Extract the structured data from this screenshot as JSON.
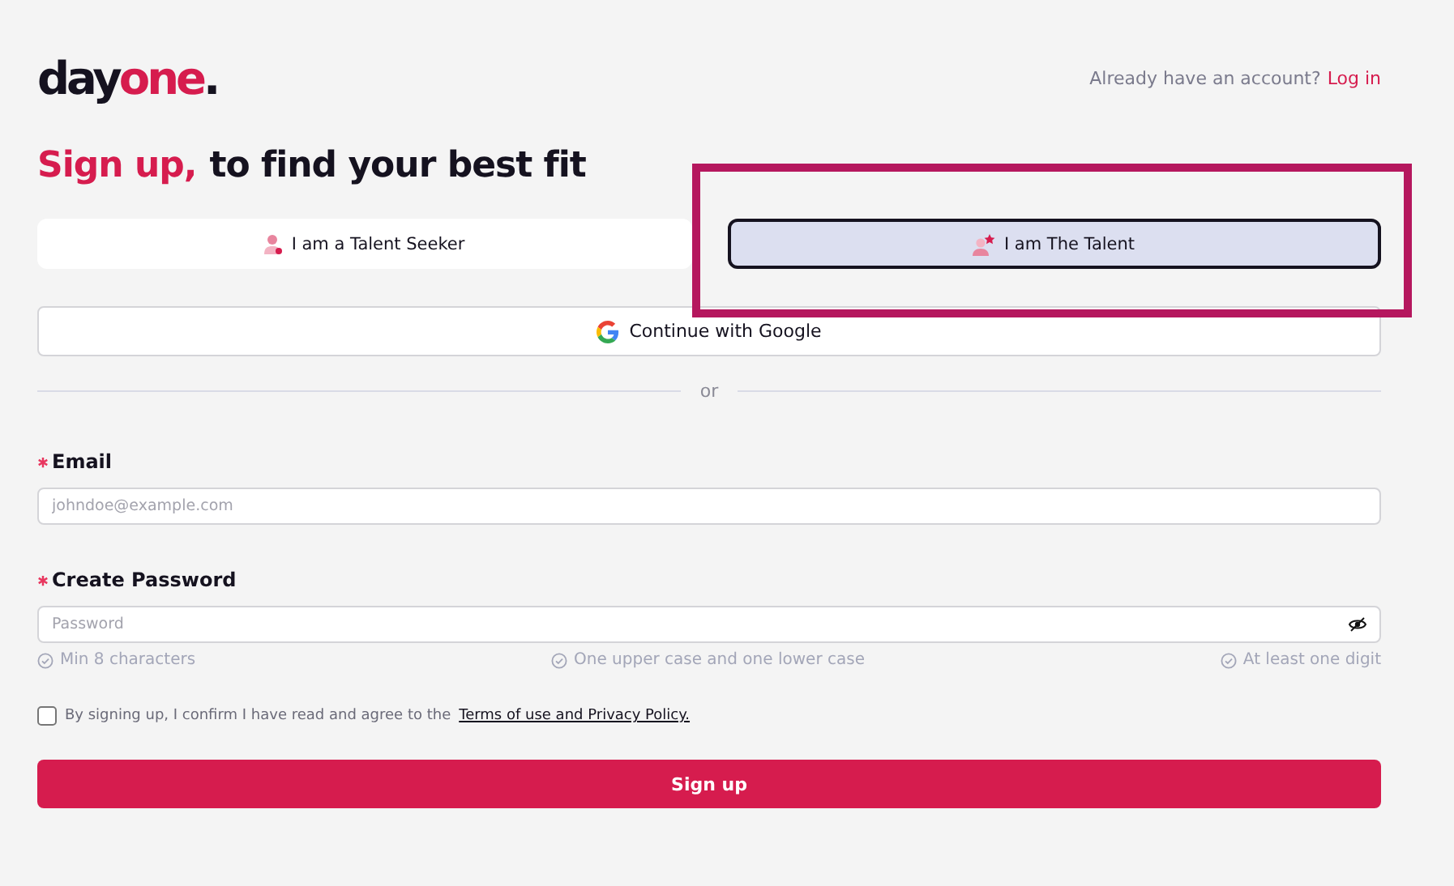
{
  "logo": {
    "first": "day",
    "second": "one",
    "dot": "."
  },
  "login_prompt": {
    "text": "Already have an account?",
    "link": "Log in"
  },
  "heading": {
    "accent": "Sign up,",
    "rest": "to find your best fit"
  },
  "roles": [
    {
      "label": "I am a Talent Seeker",
      "selected": false,
      "highlighted": false
    },
    {
      "label": "I am The Talent",
      "selected": true,
      "highlighted": true
    }
  ],
  "google_button": "Continue with Google",
  "divider": "or",
  "fields": [
    {
      "label": "Email",
      "required": true,
      "placeholder": "johndoe@example.com",
      "kind": "text"
    },
    {
      "label": "Create Password",
      "required": true,
      "placeholder": "Password",
      "kind": "password"
    }
  ],
  "password_rules": [
    {
      "text": "Min 8 characters",
      "checked": false
    },
    {
      "text": "One upper case and one lower case",
      "checked": false
    },
    {
      "text": "At least one digit",
      "checked": false
    }
  ],
  "consent": {
    "text": "By signing up, I confirm I have read and agree to the",
    "link": "Terms of use and Privacy Policy.",
    "checked": false
  },
  "submit": "Sign up"
}
